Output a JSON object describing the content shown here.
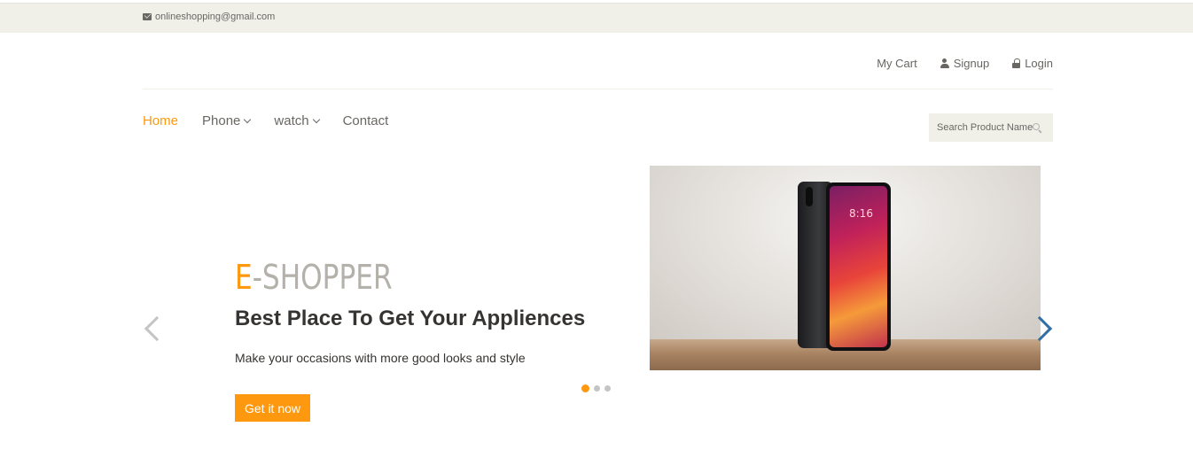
{
  "header": {
    "email": "onlineshopping@gmail.com"
  },
  "account": {
    "cart": "My Cart",
    "signup": "Signup",
    "login": "Login"
  },
  "nav": {
    "home": "Home",
    "phone": "Phone",
    "watch": "watch",
    "contact": "Contact"
  },
  "search": {
    "placeholder": "Search Product Name"
  },
  "slider": {
    "brand_accent": "E",
    "brand_rest": "-SHOPPER",
    "headline": "Best Place To Get Your Appliences",
    "tagline": "Make your occasions with more good looks and style",
    "cta": "Get it now",
    "active_slide": 1,
    "slide_count": 3,
    "phone_screen_time": "8:16"
  },
  "colors": {
    "accent": "#fe980f",
    "topbar": "#f0f0e9",
    "text": "#696763",
    "headline": "#363432",
    "next_arrow": "#2f6ea6"
  }
}
